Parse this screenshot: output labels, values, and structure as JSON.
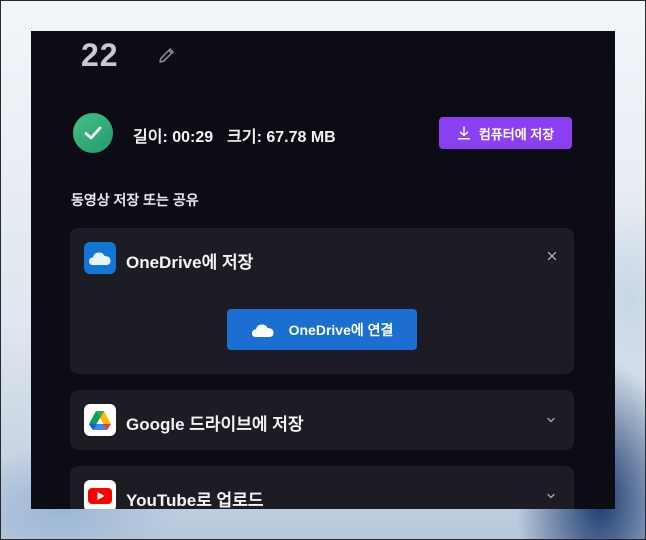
{
  "header": {
    "number": "22"
  },
  "info": {
    "length_label": "길이: 00:29",
    "size_label": "크기: 67.78 MB",
    "download_button": "컴퓨터에 저장"
  },
  "section_title": "동영상 저장 또는 공유",
  "cards": {
    "onedrive": {
      "title": "OneDrive에 저장",
      "connect_button": "OneDrive에 연결"
    },
    "google": {
      "title": "Google 드라이브에 저장"
    },
    "youtube": {
      "title": "YouTube로 업로드"
    }
  },
  "colors": {
    "accent_purple": "#8a3ff0",
    "onedrive_blue": "#1a6fd0",
    "success_green": "#2fae78",
    "panel_bg": "#0c0d14",
    "card_bg": "#1c1d24"
  }
}
